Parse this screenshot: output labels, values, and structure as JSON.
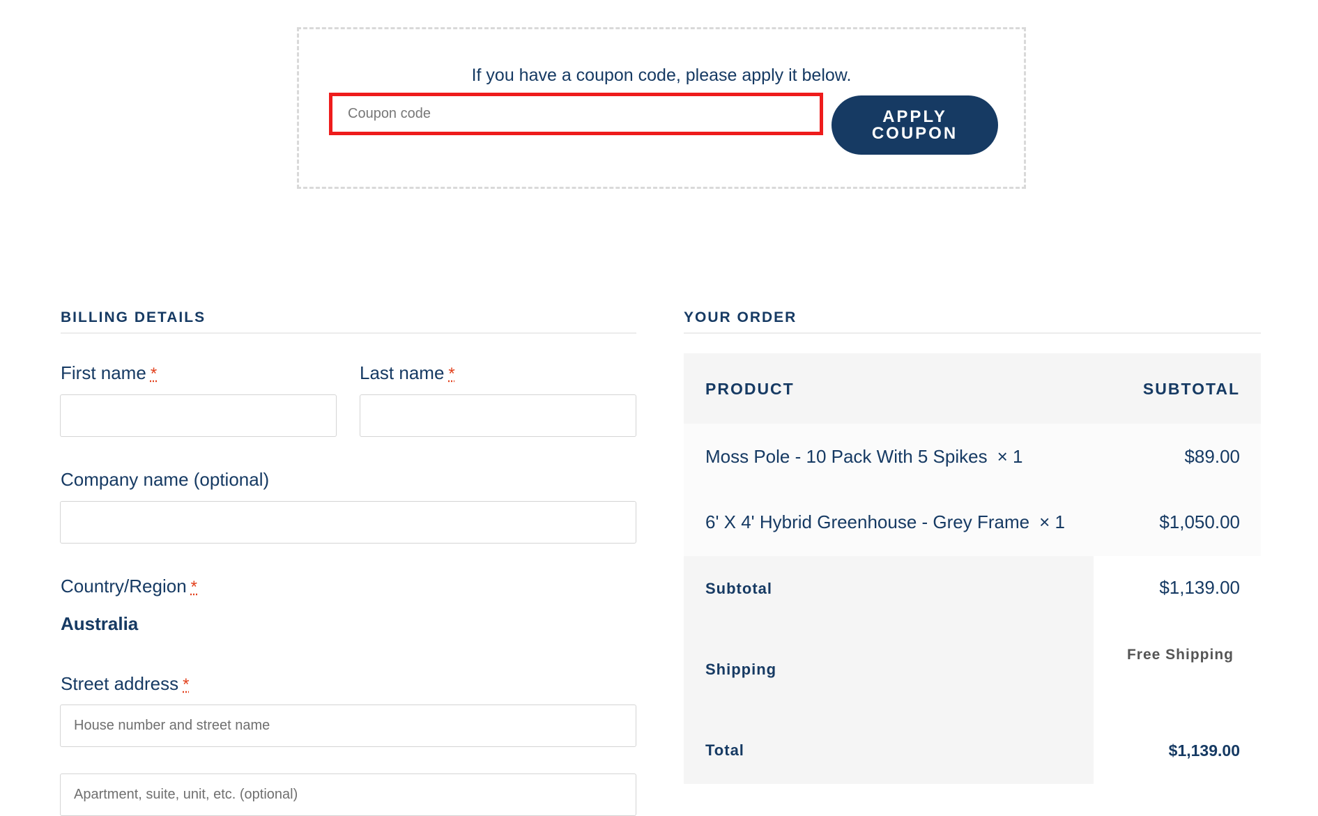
{
  "coupon": {
    "prompt": "If you have a coupon code, please apply it below.",
    "placeholder": "Coupon code",
    "value": "",
    "button_label": "APPLY COUPON"
  },
  "billing": {
    "heading": "BILLING DETAILS",
    "required_marker": "*",
    "first_name": {
      "label": "First name",
      "value": ""
    },
    "last_name": {
      "label": "Last name",
      "value": ""
    },
    "company": {
      "label": "Company name (optional)",
      "value": ""
    },
    "country": {
      "label": "Country/Region",
      "value": "Australia"
    },
    "street": {
      "label": "Street address",
      "line1_placeholder": "House number and street name",
      "line2_placeholder": "Apartment, suite, unit, etc. (optional)"
    }
  },
  "order": {
    "heading": "YOUR ORDER",
    "columns": {
      "product": "PRODUCT",
      "subtotal": "SUBTOTAL"
    },
    "items": [
      {
        "name": "Moss Pole - 10 Pack With 5 Spikes",
        "qty": "× 1",
        "amount": "$89.00"
      },
      {
        "name": "6' X 4' Hybrid Greenhouse - Grey Frame",
        "qty": "× 1",
        "amount": "$1,050.00"
      }
    ],
    "subtotal": {
      "label": "Subtotal",
      "amount": "$1,139.00"
    },
    "shipping": {
      "label": "Shipping",
      "value": "Free Shipping"
    },
    "total": {
      "label": "Total",
      "amount": "$1,139.00"
    }
  },
  "colors": {
    "brand_navy": "#163a63",
    "coupon_highlight": "#ee1c1c",
    "required": "#e2401c",
    "panel_bg": "#f5f5f5"
  }
}
